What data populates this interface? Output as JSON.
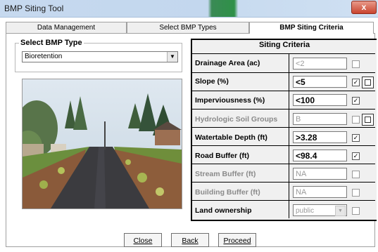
{
  "window": {
    "title": "BMP Siting Tool",
    "close_glyph": "x"
  },
  "tabs": [
    {
      "label": "Data Management"
    },
    {
      "label": "Select BMP Types"
    },
    {
      "label": "BMP Siting Criteria"
    }
  ],
  "bmp_type": {
    "group_label": "Select BMP Type",
    "selected": "Bioretention"
  },
  "siting": {
    "title": "Siting Criteria",
    "rows": [
      {
        "label": "Drainage Area (ac)",
        "value": "<2",
        "enabled": false,
        "checked": false,
        "picker": false
      },
      {
        "label": "Slope (%)",
        "value": "<5",
        "enabled": true,
        "checked": true,
        "picker": true
      },
      {
        "label": "Imperviousness (%)",
        "value": "<100",
        "enabled": true,
        "checked": true,
        "picker": false
      },
      {
        "label": "Hydrologic Soil Groups",
        "value": "B",
        "enabled": false,
        "checked": false,
        "picker": true
      },
      {
        "label": "Watertable Depth (ft)",
        "value": ">3.28",
        "enabled": true,
        "checked": true,
        "picker": false
      },
      {
        "label": "Road Buffer (ft)",
        "value": "<98.4",
        "enabled": true,
        "checked": true,
        "picker": false
      },
      {
        "label": "Stream Buffer (ft)",
        "value": "NA",
        "enabled": false,
        "checked": false,
        "picker": false
      },
      {
        "label": "Building Buffer (ft)",
        "value": "NA",
        "enabled": false,
        "checked": false,
        "picker": false
      },
      {
        "label": "Land ownership",
        "value": "public",
        "enabled": false,
        "checked": false,
        "picker": false
      }
    ]
  },
  "buttons": {
    "close": "Close",
    "back": "Back",
    "proceed": "Proceed"
  },
  "colors": {
    "accent": "#c9442f",
    "title_bar": "#c6d9ef"
  }
}
